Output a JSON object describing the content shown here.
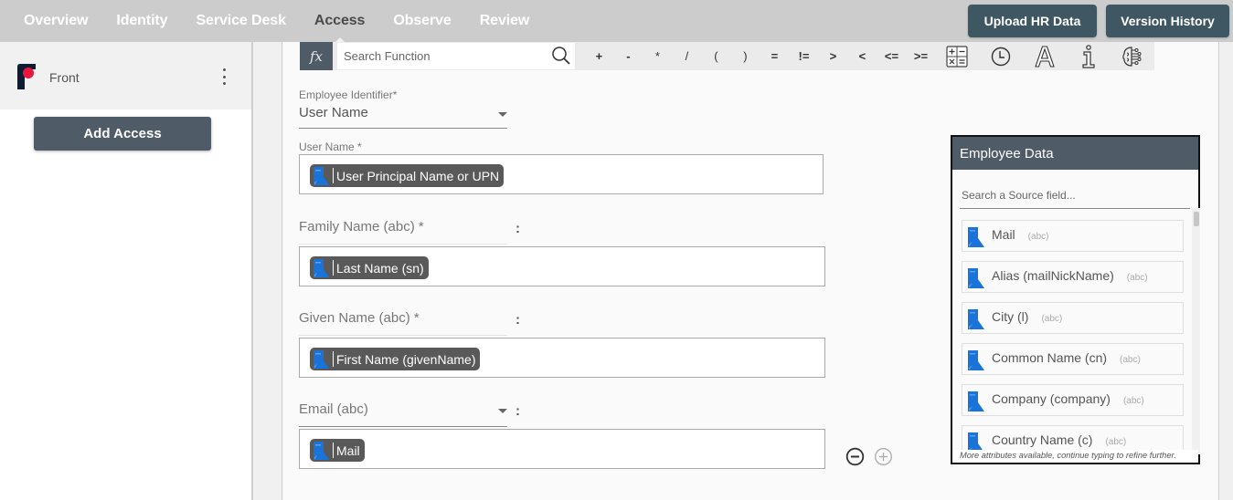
{
  "nav": {
    "tabs": [
      {
        "label": "Overview",
        "active": false
      },
      {
        "label": "Identity",
        "active": false
      },
      {
        "label": "Service Desk",
        "active": false
      },
      {
        "label": "Access",
        "active": true
      },
      {
        "label": "Observe",
        "active": false
      },
      {
        "label": "Review",
        "active": false
      }
    ],
    "upload_button": "Upload HR Data",
    "version_button": "Version History"
  },
  "sidebar": {
    "app_name": "Front",
    "add_access_label": "Add Access"
  },
  "formula_bar": {
    "fx_label": "fx",
    "search_placeholder": "Search Function",
    "operators": [
      "+",
      "-",
      "*",
      "/",
      "(",
      ")",
      "=",
      "!=",
      ">",
      "<",
      "<=",
      ">="
    ],
    "tool_icons": [
      "calculator-icon",
      "clock-icon",
      "text-icon",
      "info-icon",
      "ai-brain-icon"
    ]
  },
  "form": {
    "employee_identifier_label": "Employee Identifier*",
    "employee_identifier_value": "User Name",
    "user_name_label": "User Name *",
    "user_name_chip": "User Principal Name or UPN",
    "family_name_label": "Family Name (abc) *",
    "family_name_chip": "Last Name (sn)",
    "given_name_label": "Given Name (abc) *",
    "given_name_chip": "First Name (givenName)",
    "email_label": "Email (abc)",
    "email_chip": "Mail",
    "colon": ":"
  },
  "employee_data": {
    "title": "Employee Data",
    "search_placeholder": "Search a Source field...",
    "items": [
      {
        "name": "Mail",
        "type": "(abc)"
      },
      {
        "name": "Alias (mailNickName)",
        "type": "(abc)"
      },
      {
        "name": "City (l)",
        "type": "(abc)"
      },
      {
        "name": "Common Name (cn)",
        "type": "(abc)"
      },
      {
        "name": "Company (company)",
        "type": "(abc)"
      },
      {
        "name": "Country Name (c)",
        "type": "(abc)"
      }
    ],
    "footer": "More attributes available, continue typing to refine further."
  },
  "colors": {
    "nav_bg": "#cccccc",
    "button_dark": "#3e5762",
    "panel_header": "#4f5b66",
    "chip_bg": "#595959",
    "source_icon_blue": "#1a73d9",
    "logo_red": "#e8173f",
    "logo_navy": "#0d1b33"
  }
}
